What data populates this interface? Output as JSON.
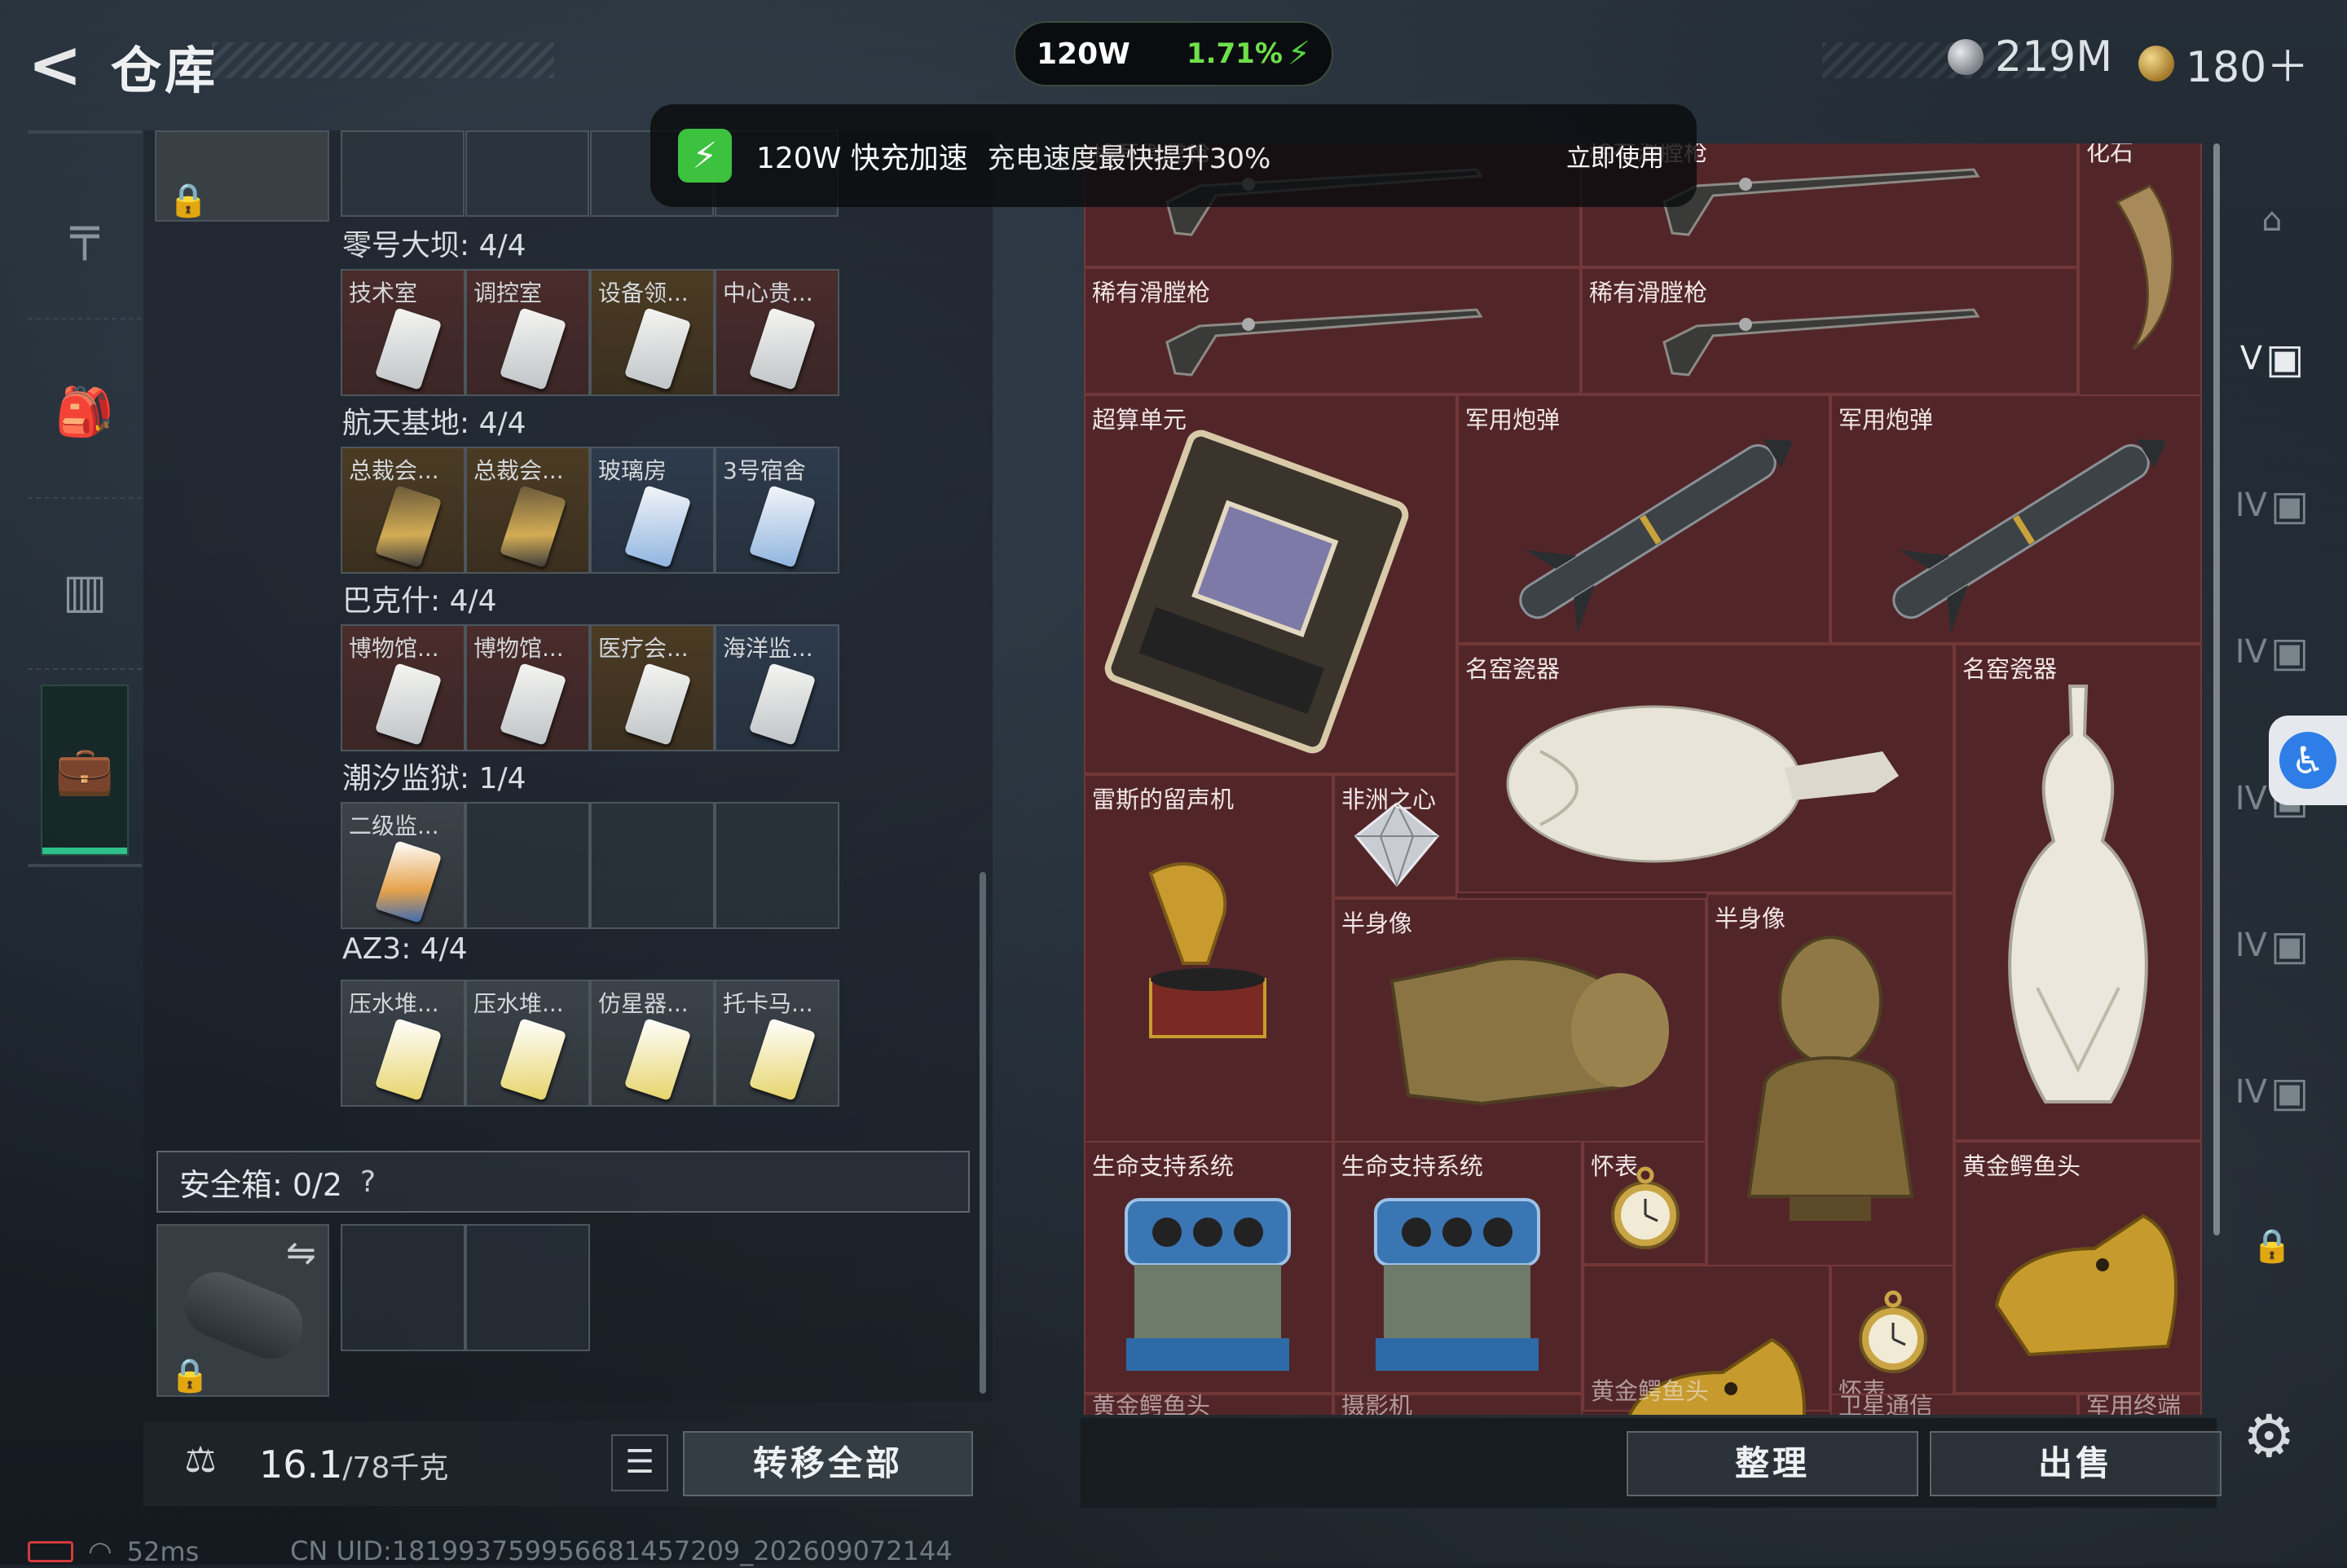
{
  "header": {
    "back_icon": "back-arrow-icon",
    "title": "仓库",
    "charge_watt": "120W",
    "charge_pct": "1.71%",
    "currency_silver": "219M",
    "currency_gold": "180＋"
  },
  "promo": {
    "title": "120W 快充加速",
    "desc": "充电速度最快提升30%",
    "action": "立即使用"
  },
  "left_nav": [
    {
      "icon": "gun-icon",
      "active": false
    },
    {
      "icon": "backpack-icon",
      "active": false
    },
    {
      "icon": "vest-icon",
      "active": false
    },
    {
      "icon": "toolbox-icon",
      "active": true
    }
  ],
  "groups": [
    {
      "title": "零号大坝: 4/4",
      "cells": [
        {
          "label": "技术室",
          "tone": "red",
          "card": "white"
        },
        {
          "label": "调控室",
          "tone": "red",
          "card": "white"
        },
        {
          "label": "设备领...",
          "tone": "gold",
          "card": "white"
        },
        {
          "label": "中心贵...",
          "tone": "red",
          "card": "white"
        }
      ]
    },
    {
      "title": "航天基地: 4/4",
      "cells": [
        {
          "label": "总裁会...",
          "tone": "gold",
          "card": "gold"
        },
        {
          "label": "总裁会...",
          "tone": "gold",
          "card": "gold"
        },
        {
          "label": "玻璃房",
          "tone": "blue",
          "card": "blue"
        },
        {
          "label": "3号宿舍",
          "tone": "blue",
          "card": "blue"
        }
      ]
    },
    {
      "title": "巴克什: 4/4",
      "cells": [
        {
          "label": "博物馆...",
          "tone": "red",
          "card": "white"
        },
        {
          "label": "博物馆...",
          "tone": "red",
          "card": "white"
        },
        {
          "label": "医疗会...",
          "tone": "gold",
          "card": "white"
        },
        {
          "label": "海洋监...",
          "tone": "blue",
          "card": "white"
        }
      ]
    },
    {
      "title": "潮汐监狱: 1/4",
      "cells": [
        {
          "label": "二级监...",
          "tone": "grey",
          "card": "orange"
        },
        {
          "label": "",
          "tone": "",
          "card": ""
        },
        {
          "label": "",
          "tone": "",
          "card": ""
        },
        {
          "label": "",
          "tone": "",
          "card": ""
        }
      ]
    },
    {
      "title": "AZ3: 4/4",
      "cells": [
        {
          "label": "压水堆...",
          "tone": "grey",
          "card": "yellow"
        },
        {
          "label": "压水堆...",
          "tone": "grey",
          "card": "yellow"
        },
        {
          "label": "仿星器...",
          "tone": "grey",
          "card": "yellow"
        },
        {
          "label": "托卡马...",
          "tone": "grey",
          "card": "yellow"
        }
      ]
    }
  ],
  "safe": {
    "label": "安全箱: 0/2",
    "help": "?"
  },
  "weight": {
    "current": "16.1",
    "max": "/78千克"
  },
  "buttons": {
    "transfer_all": "转移全部",
    "sort": "整理",
    "sell": "出售"
  },
  "status": {
    "ping": "52ms",
    "uid": "CN UID:18199375995668145720​9_202609072144"
  },
  "grid_items": [
    {
      "label": "稀有滑膛枪",
      "art": "musket"
    },
    {
      "label": "稀有滑膛枪",
      "art": "musket"
    },
    {
      "label": "化石",
      "art": "fossil"
    },
    {
      "label": "稀有滑膛枪",
      "art": "musket"
    },
    {
      "label": "稀有滑膛枪",
      "art": "musket"
    },
    {
      "label": "超算单元",
      "art": "gpu"
    },
    {
      "label": "军用炮弹",
      "art": "missile"
    },
    {
      "label": "军用炮弹",
      "art": "missile"
    },
    {
      "label": "名窑瓷器",
      "art": "vase-lying"
    },
    {
      "label": "名窑瓷器",
      "art": "vase"
    },
    {
      "label": "雷斯的留声机",
      "art": "gramophone"
    },
    {
      "label": "非洲之心",
      "art": "diamond"
    },
    {
      "label": "半身像",
      "art": "bust-lying"
    },
    {
      "label": "半身像",
      "art": "bust"
    },
    {
      "label": "生命支持系统",
      "art": "lifesupport"
    },
    {
      "label": "生命支持系统",
      "art": "lifesupport"
    },
    {
      "label": "怀表",
      "art": "watch"
    },
    {
      "label": "黄金鳄鱼头",
      "art": "croc"
    },
    {
      "label": "黄金鳄鱼头",
      "art": "croc"
    },
    {
      "label": "怀表",
      "art": "watch"
    },
    {
      "label": "黄金鳄鱼头",
      "art": ""
    },
    {
      "label": "摄影机",
      "art": ""
    },
    {
      "label": "卫星通信",
      "art": ""
    },
    {
      "label": "军用终端",
      "art": ""
    }
  ],
  "right_nav": [
    {
      "icon": "storage-room-icon",
      "active": false
    },
    {
      "icon": "safe-v-icon",
      "active": true,
      "text": "V"
    },
    {
      "icon": "safe-iv-icon",
      "active": false,
      "text": "IV"
    },
    {
      "icon": "safe-iv-icon",
      "active": false,
      "text": "IV"
    },
    {
      "icon": "safe-iv-icon",
      "active": false,
      "text": "IV"
    },
    {
      "icon": "safe-iv-icon",
      "active": false,
      "text": "IV"
    },
    {
      "icon": "safe-iv-icon",
      "active": false,
      "text": "IV"
    }
  ]
}
